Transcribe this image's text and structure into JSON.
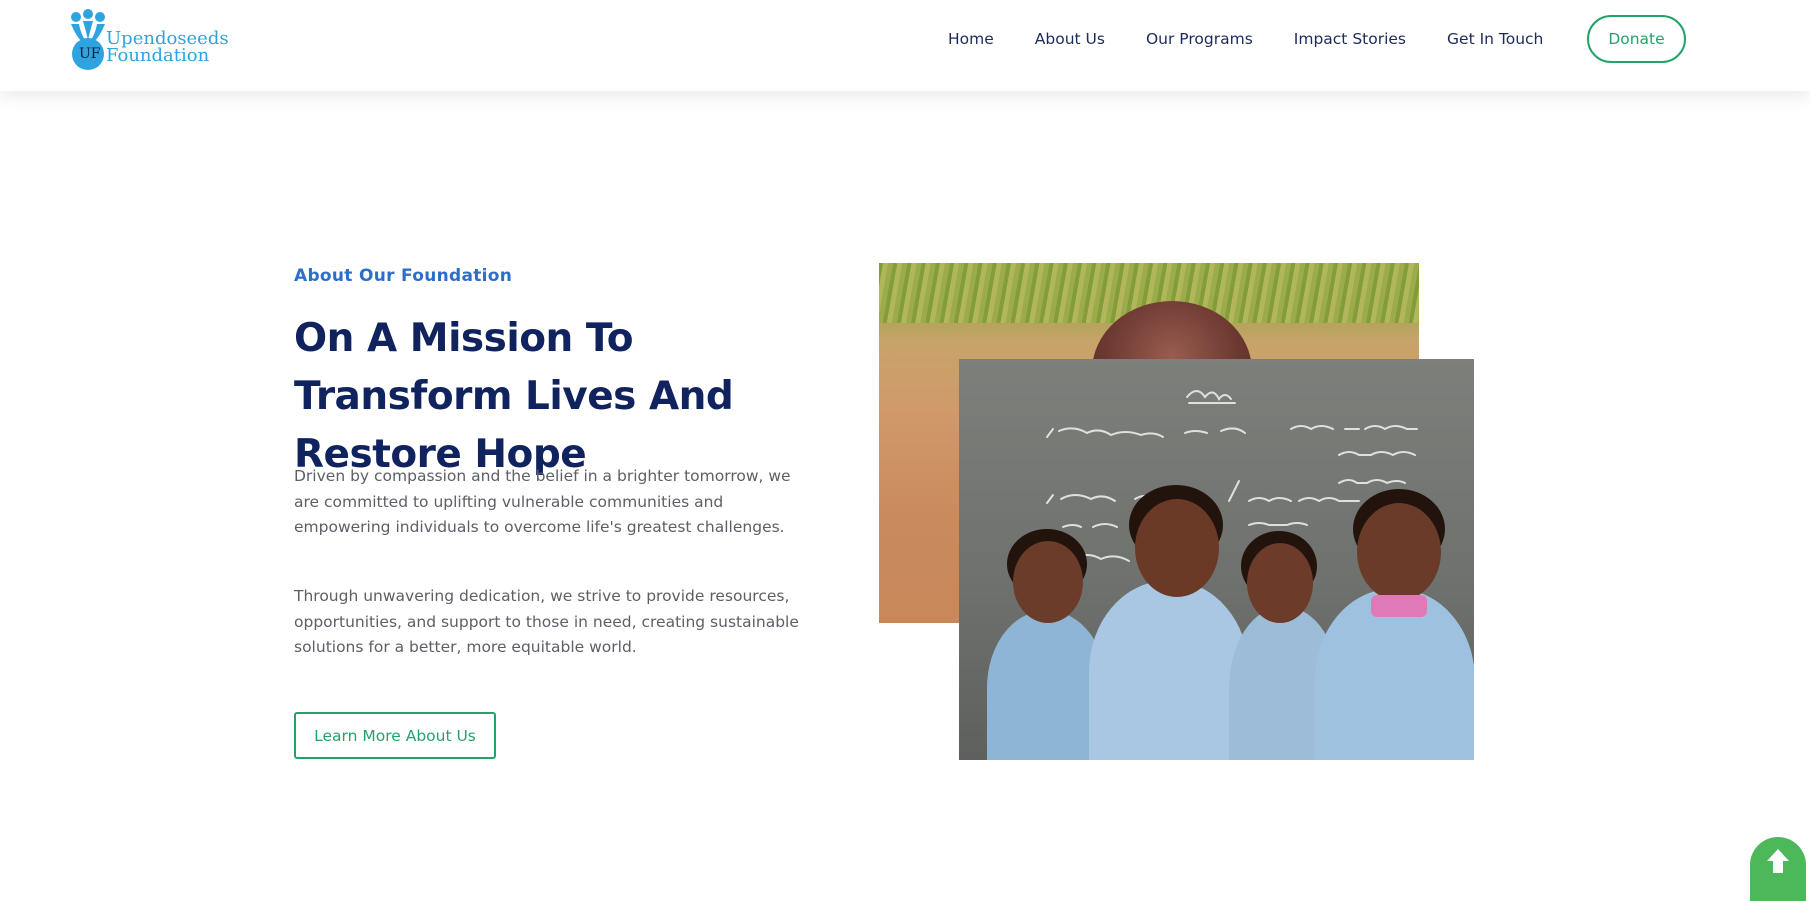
{
  "brand": {
    "logo_line1": "Upendoseeds",
    "logo_line2": "Foundation",
    "logo_mark": "UF",
    "color_primary": "#2ea3e0",
    "color_accent": "#23a36a",
    "color_heading": "#10235f"
  },
  "nav": {
    "items": [
      {
        "label": "Home"
      },
      {
        "label": "About Us"
      },
      {
        "label": "Our Programs"
      },
      {
        "label": "Impact Stories"
      },
      {
        "label": "Get In Touch"
      }
    ],
    "donate_label": "Donate"
  },
  "about": {
    "eyebrow": "About Our Foundation",
    "headline": "On A Mission To Transform Lives And Restore Hope",
    "paragraph1": "Driven by compassion and the belief in a brighter tomorrow, we are committed to uplifting vulnerable communities and empowering individuals to overcome life's greatest challenges.",
    "paragraph2": "Through unwavering dedication, we strive to provide resources, opportunities, and support to those in need, creating sustainable solutions for a better, more equitable world.",
    "cta_label": "Learn More About Us"
  },
  "images": {
    "back_photo": "child-portrait-photo",
    "front_photo": "schoolgirls-chalkboard-photo"
  },
  "icons": {
    "back_to_top": "arrow-up-icon"
  }
}
